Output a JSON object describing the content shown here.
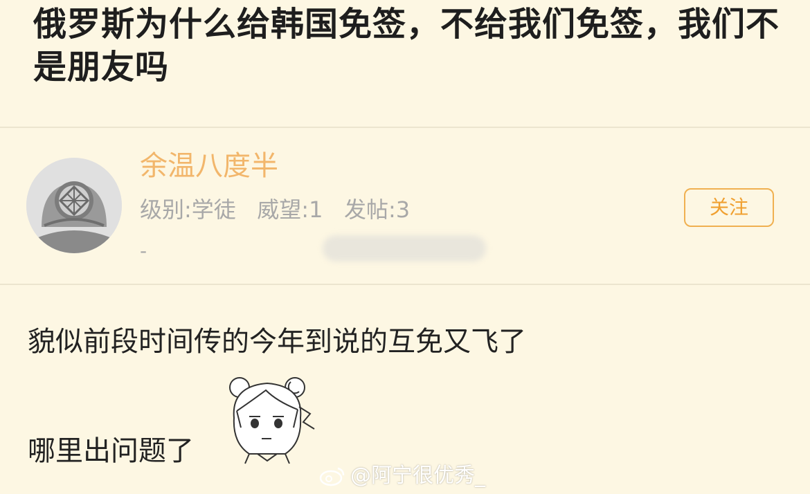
{
  "post": {
    "title": "俄罗斯为什么给韩国免签，不给我们免签，我们不是朋友吗"
  },
  "reply": {
    "username": "余温八度半",
    "meta": "级别:学徒   威望:1   发帖:3",
    "dash": "-",
    "follow_label": "关注",
    "content_line1": "貌似前段时间传的今年到说的互免又飞了",
    "content_line2": "哪里出问题了"
  },
  "watermark": {
    "text": "@阿宁很优秀_"
  },
  "colors": {
    "background": "#fdf7e3",
    "username": "#f2b66b",
    "accent": "#f0a030",
    "meta": "#a8a8a8"
  },
  "icons": {
    "avatar": "diving-helmet-icon",
    "sticker": "anime-girl-sticker",
    "watermark": "weibo-icon"
  }
}
